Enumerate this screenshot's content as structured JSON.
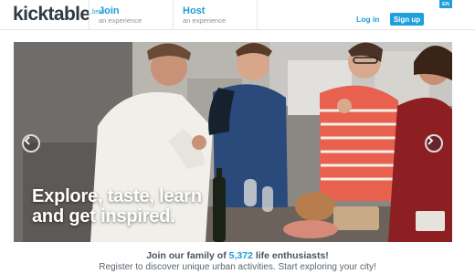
{
  "header": {
    "logo_text": "kicktable",
    "logo_badge": "beta",
    "join": {
      "title": "Join",
      "subtitle": "an experience"
    },
    "host": {
      "title": "Host",
      "subtitle": "an experience"
    },
    "login_label": "Log in",
    "signup_label": "Sign up",
    "language": "EN"
  },
  "hero": {
    "headline_line1": "Explore, taste, learn",
    "headline_line2": "and get inspired.",
    "prev_icon": "chevron-left-icon",
    "next_icon": "chevron-right-icon"
  },
  "footer": {
    "tagline_prefix": "Join our family of",
    "member_count": "5,372",
    "tagline_suffix": "life enthusiasts!",
    "subline": "Register to discover unique urban activities. Start exploring your city!"
  },
  "colors": {
    "accent": "#1ea0dc",
    "text_dark": "#2e3a42"
  }
}
